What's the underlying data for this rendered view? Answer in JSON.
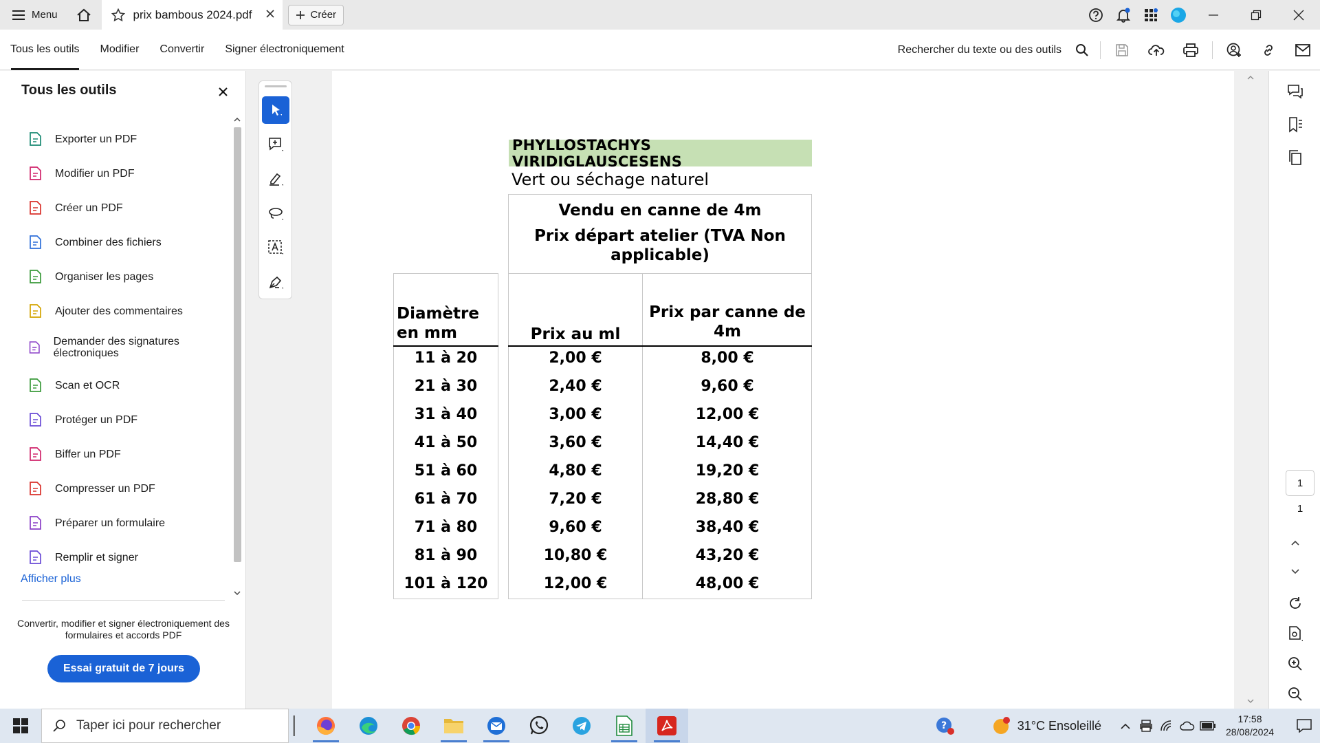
{
  "titlebar": {
    "menu_label": "Menu",
    "tab_title": "prix bambous 2024.pdf",
    "create_label": "Créer"
  },
  "toolbar": {
    "tabs": [
      "Tous les outils",
      "Modifier",
      "Convertir",
      "Signer électroniquement"
    ],
    "search_label": "Rechercher du texte ou des outils"
  },
  "left_panel": {
    "title": "Tous les outils",
    "tools": [
      {
        "label": "Exporter un PDF",
        "icon": "export-pdf-icon",
        "color": "#1a8a73"
      },
      {
        "label": "Modifier un PDF",
        "icon": "edit-pdf-icon",
        "color": "#d0246b"
      },
      {
        "label": "Créer un PDF",
        "icon": "create-pdf-icon",
        "color": "#d9302a"
      },
      {
        "label": "Combiner des fichiers",
        "icon": "combine-files-icon",
        "color": "#2e6fd9"
      },
      {
        "label": "Organiser les pages",
        "icon": "organize-pages-icon",
        "color": "#3a9a3a"
      },
      {
        "label": "Ajouter des commentaires",
        "icon": "comment-icon",
        "color": "#d4a400"
      },
      {
        "label": "Demander des signatures électroniques",
        "icon": "request-signature-icon",
        "color": "#8a3ec7"
      },
      {
        "label": "Scan et OCR",
        "icon": "scan-ocr-icon",
        "color": "#3a9a3a"
      },
      {
        "label": "Protéger un PDF",
        "icon": "protect-pdf-icon",
        "color": "#6a4bd6"
      },
      {
        "label": "Biffer un PDF",
        "icon": "redact-pdf-icon",
        "color": "#d0246b"
      },
      {
        "label": "Compresser un PDF",
        "icon": "compress-pdf-icon",
        "color": "#d9302a"
      },
      {
        "label": "Préparer un formulaire",
        "icon": "prepare-form-icon",
        "color": "#8a3ec7"
      },
      {
        "label": "Remplir et signer",
        "icon": "fill-sign-icon",
        "color": "#6a4bd6"
      }
    ],
    "show_more": "Afficher plus",
    "promo_text": "Convertir, modifier et signer électroniquement des formulaires et accords PDF",
    "trial_button": "Essai gratuit de 7 jours"
  },
  "document": {
    "species": "PHYLLOSTACHYS VIRIDIGLAUSCESENS",
    "subtitle": "Vert ou séchage naturel",
    "header_line1": "Vendu en canne de 4m",
    "header_line2": "Prix départ atelier (TVA Non applicable)",
    "columns": [
      "Diamètre en mm",
      "Prix au ml",
      "Prix par canne de 4m"
    ],
    "rows": [
      [
        "11 à 20",
        "2,00 €",
        "8,00 €"
      ],
      [
        "21 à 30",
        "2,40 €",
        "9,60 €"
      ],
      [
        "31 à 40",
        "3,00 €",
        "12,00 €"
      ],
      [
        "41 à 50",
        "3,60 €",
        "14,40 €"
      ],
      [
        "51 à 60",
        "4,80 €",
        "19,20 €"
      ],
      [
        "61 à 70",
        "7,20 €",
        "28,80 €"
      ],
      [
        "71 à 80",
        "9,60 €",
        "38,40 €"
      ],
      [
        "81 à 90",
        "10,80 €",
        "43,20 €"
      ],
      [
        "101 à 120",
        "12,00 €",
        "48,00 €"
      ]
    ]
  },
  "page_nav": {
    "current": "1",
    "total": "1"
  },
  "taskbar": {
    "search_placeholder": "Taper ici pour rechercher",
    "weather": "31°C  Ensoleillé",
    "time": "17:58",
    "date": "28/08/2024"
  },
  "colors": {
    "accent": "#1a62d6",
    "species_bg": "#c6e0b4"
  }
}
